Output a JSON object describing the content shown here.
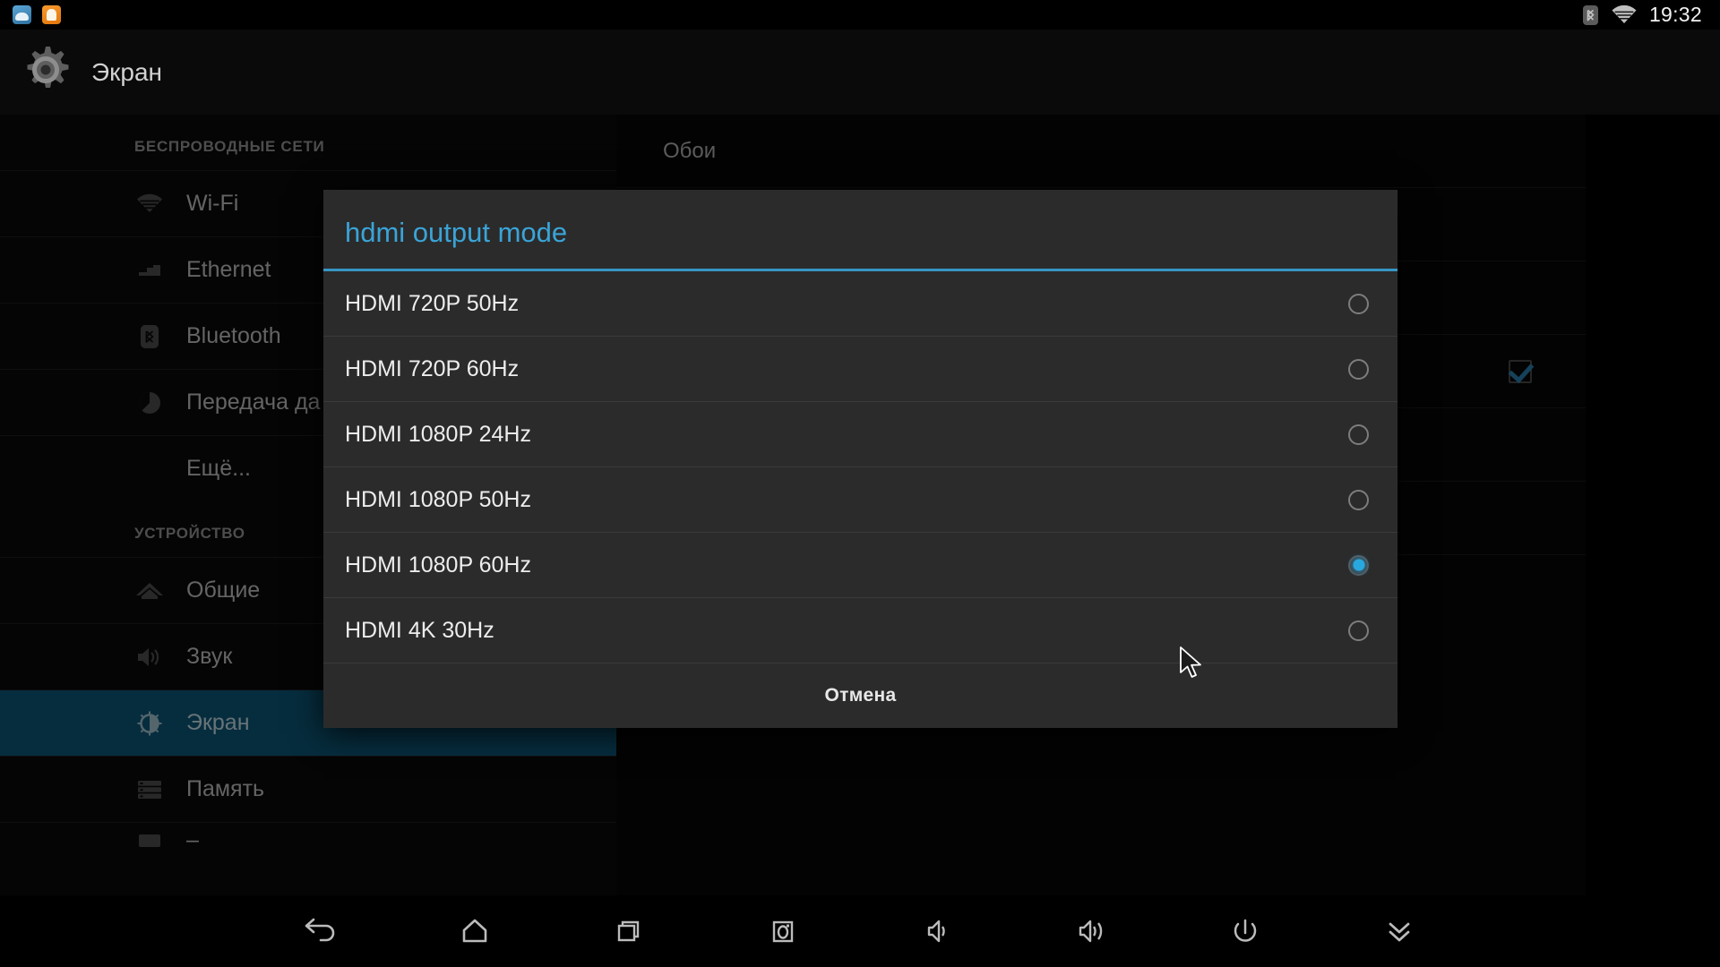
{
  "status_bar": {
    "app_icons": [
      "downloads-icon",
      "app-icon-orange"
    ],
    "bluetooth_icon": "bluetooth-icon",
    "wifi_icon": "wifi-icon",
    "clock": "19:32"
  },
  "action_bar": {
    "settings_icon": "gear-icon",
    "title": "Экран"
  },
  "sidebar": {
    "sections": [
      {
        "header": "БЕСПРОВОДНЫЕ СЕТИ",
        "items": [
          {
            "label": "Wi-Fi",
            "icon": "wifi-icon",
            "selected": false
          },
          {
            "label": "Ethernet",
            "icon": "ethernet-icon",
            "selected": false
          },
          {
            "label": "Bluetooth",
            "icon": "bluetooth-icon",
            "selected": false
          },
          {
            "label": "Передача да",
            "icon": "data-usage-icon",
            "selected": false
          },
          {
            "label": "Ещё...",
            "icon": "",
            "selected": false
          }
        ]
      },
      {
        "header": "УСТРОЙСТВО",
        "items": [
          {
            "label": "Общие",
            "icon": "home-icon",
            "selected": false
          },
          {
            "label": "Звук",
            "icon": "sound-icon",
            "selected": false
          },
          {
            "label": "Экран",
            "icon": "display-icon",
            "selected": true
          },
          {
            "label": "Память",
            "icon": "storage-icon",
            "selected": false
          }
        ]
      }
    ]
  },
  "right_pane": {
    "items": [
      {
        "label": "Обои",
        "has_checkbox": false
      },
      {
        "label": "",
        "has_checkbox": false
      },
      {
        "label": "",
        "has_checkbox": false
      },
      {
        "label": "",
        "has_checkbox": true
      },
      {
        "label": "",
        "has_checkbox": false
      },
      {
        "label": "",
        "has_checkbox": false
      }
    ]
  },
  "dialog": {
    "title": "hdmi output mode",
    "options": [
      {
        "label": "HDMI 720P 50Hz",
        "selected": false
      },
      {
        "label": "HDMI 720P 60Hz",
        "selected": false
      },
      {
        "label": "HDMI 1080P 24Hz",
        "selected": false
      },
      {
        "label": "HDMI 1080P 50Hz",
        "selected": false
      },
      {
        "label": "HDMI 1080P 60Hz",
        "selected": true
      },
      {
        "label": "HDMI 4K 30Hz",
        "selected": false
      }
    ],
    "cancel_label": "Отмена"
  },
  "nav_bar": {
    "buttons": [
      "back-icon",
      "home-icon",
      "recents-icon",
      "screenshot-icon",
      "volume-down-icon",
      "volume-up-icon",
      "power-icon",
      "collapse-icon"
    ]
  },
  "colors": {
    "accent": "#3aa4d8",
    "selection": "#0d5b7d",
    "dialog_bg": "#2b2b2b",
    "radio_on": "#29a8e0"
  }
}
